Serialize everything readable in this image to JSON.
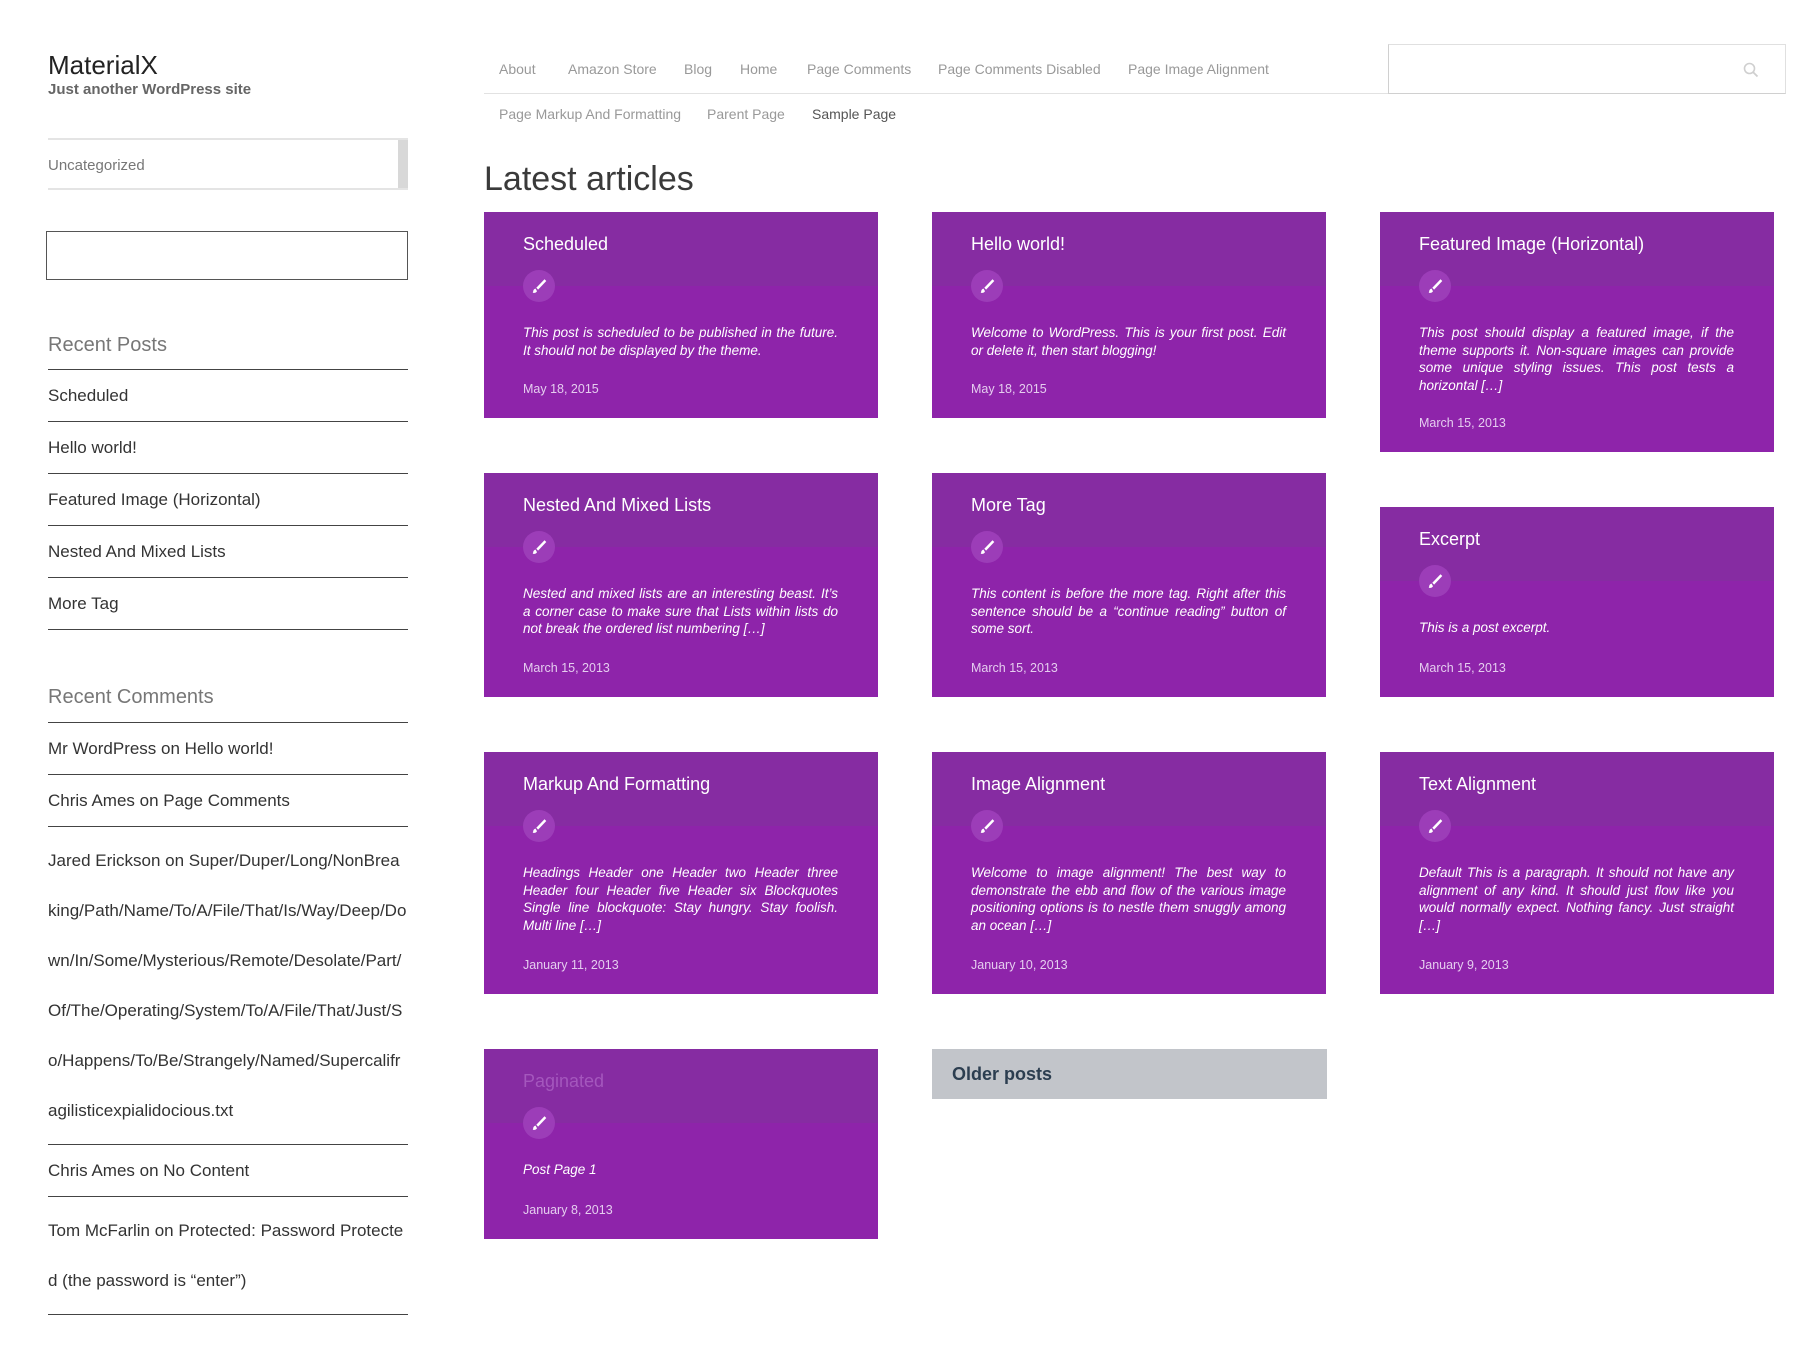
{
  "site": {
    "title": "MaterialX",
    "description": "Just another WordPress site"
  },
  "sidebar": {
    "category_select": "Uncategorized",
    "recent_posts_title": "Recent Posts",
    "recent_posts": [
      "Scheduled",
      "Hello world!",
      "Featured Image (Horizontal)",
      "Nested And Mixed Lists",
      "More Tag"
    ],
    "recent_comments_title": "Recent Comments",
    "recent_comments": [
      "Mr WordPress on Hello world!",
      "Chris Ames on Page Comments",
      "Jared Erickson on Super/Duper/Long/NonBreaking/Path/Name/To/A/File/That/Is/Way/Deep/Down/In/Some/Mysterious/Remote/Desolate/Part/Of/The/Operating/System/To/A/File/That/Just/So/Happens/To/Be/Strangely/Named/Supercalifragilisticexpialidocious.txt",
      "Chris Ames on No Content",
      "Tom McFarlin on Protected: Password Protected (the password is “enter”)"
    ]
  },
  "nav": {
    "items": [
      "About",
      "Amazon Store",
      "Blog",
      "Home",
      "Page Comments",
      "Page Comments Disabled",
      "Page Image Alignment",
      "Page Markup And Formatting",
      "Parent Page",
      "Sample Page"
    ],
    "current": "Sample Page"
  },
  "main": {
    "heading": "Latest articles",
    "cards": [
      {
        "title": "Scheduled",
        "excerpt": "This post is scheduled to be published in the future. It should not be displayed by the theme.",
        "date": "May 18, 2015"
      },
      {
        "title": "Hello world!",
        "excerpt": "Welcome to WordPress. This is your first post. Edit or delete it, then start blogging!",
        "date": "May 18, 2015"
      },
      {
        "title": "Featured Image (Horizontal)",
        "excerpt": "This post should display a featured image, if the theme supports it. Non-square images can provide some unique styling issues. This post tests a horizontal […]",
        "date": "March 15, 2013"
      },
      {
        "title": "Nested And Mixed Lists",
        "excerpt": "Nested and mixed lists are an interesting beast. It’s a corner case to make sure that Lists within lists do not break the ordered list numbering […]",
        "date": "March 15, 2013"
      },
      {
        "title": "More Tag",
        "excerpt": "This content is before the more tag. Right after this sentence should be a “continue reading” button of some sort.",
        "date": "March 15, 2013"
      },
      {
        "title": "Excerpt",
        "excerpt": "This is a post excerpt.",
        "date": "March 15, 2013"
      },
      {
        "title": "Markup And Formatting",
        "excerpt": "Headings Header one Header two Header three Header four Header five Header six Blockquotes Single line blockquote: Stay hungry. Stay foolish. Multi line […]",
        "date": "January 11, 2013"
      },
      {
        "title": "Image Alignment",
        "excerpt": "Welcome to image alignment! The best way to demonstrate the ebb and flow of the various image positioning options is to nestle them snuggly among an ocean […]",
        "date": "January 10, 2013"
      },
      {
        "title": "Text Alignment",
        "excerpt": "Default This is a paragraph. It should not have any alignment of any kind. It should just flow like you would normally expect. Nothing fancy. Just straight […]",
        "date": "January 9, 2013"
      },
      {
        "title": "Paginated",
        "excerpt": "Post Page 1",
        "date": "January 8, 2013"
      }
    ],
    "older_posts_label": "Older posts"
  },
  "icons": {
    "search": "search-icon",
    "card": "brush-icon"
  },
  "colors": {
    "card_bg": "#8e24aa",
    "card_head": "#862ca2",
    "older_posts_bg": "#c2c5ca"
  }
}
